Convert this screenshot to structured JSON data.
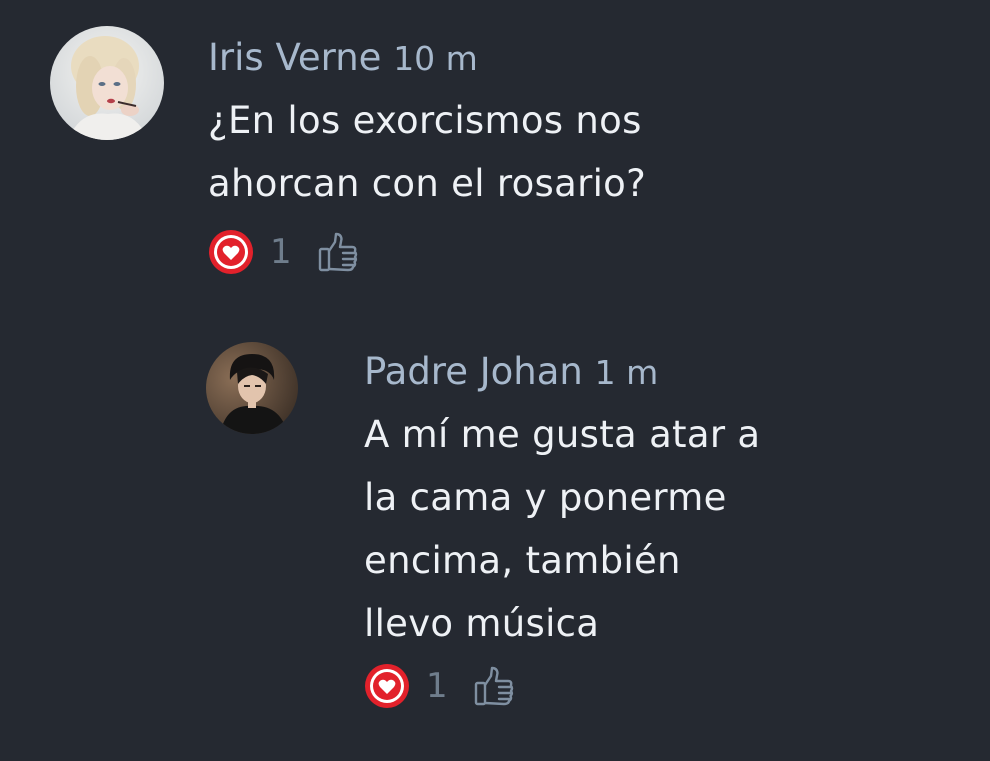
{
  "comments": [
    {
      "author": "Iris Verne",
      "time": "10 m",
      "text_lines": [
        "¿En los exorcismos nos",
        "ahorcan con el rosario?"
      ],
      "likes": "1",
      "avatar_icon": "avatar-blonde-woman",
      "like_icon": "heart-icon",
      "thumb_icon": "thumbs-up-icon"
    },
    {
      "author": "Padre Johan",
      "time": "1 m",
      "text_lines": [
        "A mí me gusta atar a",
        "la cama y ponerme",
        "encima, también",
        "llevo música"
      ],
      "likes": "1",
      "avatar_icon": "avatar-dark-haired-man",
      "like_icon": "heart-icon",
      "thumb_icon": "thumbs-up-icon"
    }
  ],
  "colors": {
    "background": "#252931",
    "author": "#a7b8cc",
    "text": "#eef1f5",
    "count": "#6f7d8c",
    "like_red": "#e2212b"
  }
}
